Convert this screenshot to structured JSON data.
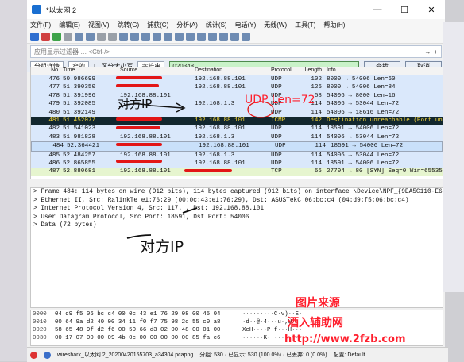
{
  "window": {
    "title": "*以太网 2",
    "controls": [
      "—",
      "☐",
      "✕"
    ]
  },
  "menu": [
    "文件(F)",
    "编辑(E)",
    "视图(V)",
    "跳转(G)",
    "捕获(C)",
    "分析(A)",
    "统计(S)",
    "电话(Y)",
    "无线(W)",
    "工具(T)",
    "帮助(H)"
  ],
  "display_filter": {
    "placeholder": "应用显示过滤器 … <Ctrl-/>",
    "bookmark": "→",
    "expression": "+"
  },
  "find_bar": {
    "search_in": "分组详情",
    "char_width": "窄的",
    "case_label": "区分大小写",
    "search_type": "字符串",
    "search_value": "020348",
    "find_button": "查找",
    "cancel_button": "取消"
  },
  "packet_list": {
    "columns": [
      "No.",
      "Time",
      "Source",
      "Destination",
      "Protocol",
      "Length",
      "Info"
    ],
    "rows": [
      {
        "no": "476",
        "time": "50.986699",
        "src": "",
        "dst": "192.168.88.101",
        "proto": "UDP",
        "len": "102",
        "info": "8000 → 54006 Len=60",
        "style": ""
      },
      {
        "no": "477",
        "time": "51.390350",
        "src": "",
        "dst": "192.168.88.101",
        "proto": "UDP",
        "len": "126",
        "info": "8000 → 54006 Len=84",
        "style": ""
      },
      {
        "no": "478",
        "time": "51.391996",
        "src": "192.168.88.101",
        "dst": "",
        "proto": "UDP",
        "len": "58",
        "info": "54006 → 8000 Len=16",
        "style": ""
      },
      {
        "no": "479",
        "time": "51.392085",
        "src": "",
        "dst": "192.168.1.3",
        "proto": "UDP",
        "len": "114",
        "info": "54006 → 53044 Len=72",
        "style": ""
      },
      {
        "no": "480",
        "time": "51.392149",
        "src": "",
        "dst": "",
        "proto": "UDP",
        "len": "114",
        "info": "54006 → 18616 Len=72",
        "style": ""
      },
      {
        "no": "481",
        "time": "51.452077",
        "src": "",
        "dst": "192.168.88.101",
        "proto": "ICMP",
        "len": "142",
        "info": "Destination unreachable (Port unrea",
        "style": "icmp"
      },
      {
        "no": "482",
        "time": "51.541023",
        "src": "",
        "dst": "192.168.88.101",
        "proto": "UDP",
        "len": "114",
        "info": "18591 → 54006 Len=72",
        "style": ""
      },
      {
        "no": "483",
        "time": "51.981828",
        "src": "192.168.88.101",
        "dst": "192.168.1.3",
        "proto": "UDP",
        "len": "114",
        "info": "54006 → 53044 Len=72",
        "style": ""
      },
      {
        "no": "484",
        "time": "52.364421",
        "src": "",
        "dst": "192.168.88.101",
        "proto": "UDP",
        "len": "114",
        "info": "18591 → 54006 Len=72",
        "style": "sel"
      },
      {
        "no": "485",
        "time": "52.484257",
        "src": "192.168.88.101",
        "dst": "192.168.1.3",
        "proto": "UDP",
        "len": "114",
        "info": "54006 → 53044 Len=72",
        "style": ""
      },
      {
        "no": "486",
        "time": "52.865855",
        "src": "",
        "dst": "192.168.88.101",
        "proto": "UDP",
        "len": "114",
        "info": "18591 → 54006 Len=72",
        "style": ""
      },
      {
        "no": "487",
        "time": "52.880681",
        "src": "192.168.88.101",
        "dst": "",
        "proto": "TCP",
        "len": "66",
        "info": "27704 → 80 [SYN] Seq=0 Win=65535 Le",
        "style": "tcp"
      }
    ]
  },
  "details": [
    "> Frame 484: 114 bytes on wire (912 bits), 114 bytes captured (912 bits) on interface \\Device\\NPF_{9EA5C110-E678-4306-A",
    "> Ethernet II, Src: RalinkTe_e1:76:29 (00:0c:43:e1:76:29), Dst: ASUSTekC_06:bc:c4 (04:d9:f5:06:bc:c4)",
    "> Internet Protocol Version 4, Src: 117.        , Dst: 192.168.88.101",
    "> User Datagram Protocol, Src Port: 18591, Dst Port: 54006",
    "> Data (72 bytes)"
  ],
  "hex": [
    {
      "off": "0000",
      "bytes": "04 d9 f5 06 bc c4 00 0c  43 e1 76 29 08 00 45 04",
      "ascii": "·········C·v)··E·"
    },
    {
      "off": "0010",
      "bytes": "00 64 9a d2 40 00 34 11  f0 f7 75 98 2c 55 c0 a8",
      "ascii": "·d··@·4···u·,U··"
    },
    {
      "off": "0020",
      "bytes": "58 65 48 9f d2 f6 00 50  66 d3 02 00 48 00 01 00",
      "ascii": "XeH····P f···H···"
    },
    {
      "off": "0030",
      "bytes": "00 17 07 00 00 09 4b 0c  00 00 00 00 00 85 fa c6",
      "ascii": "······K· ········"
    }
  ],
  "status": {
    "file": "wireshark_以太网 2_20200420155703_a34304.pcapng",
    "groups": "分组: 530 · 已显示: 530 (100.0%) · 已丢弃: 0 (0.0%)",
    "profile": "配置: Default"
  },
  "annotations": {
    "udp_note": "UDP  Len=72",
    "target_ip": "对方IP",
    "self_ip": "对方IP"
  },
  "watermark": {
    "line1": "图片来源",
    "line2": "酒入辅助网",
    "line3": "http://www.2fzb.com"
  },
  "colors": {
    "selected_row": "#c9e0fa",
    "icmp_row": "#12272e",
    "tcp_row": "#e6f5cf",
    "udp_row": "#dae8fb",
    "filter_input": "#c9f2c9",
    "mark_red": "#e31616"
  }
}
